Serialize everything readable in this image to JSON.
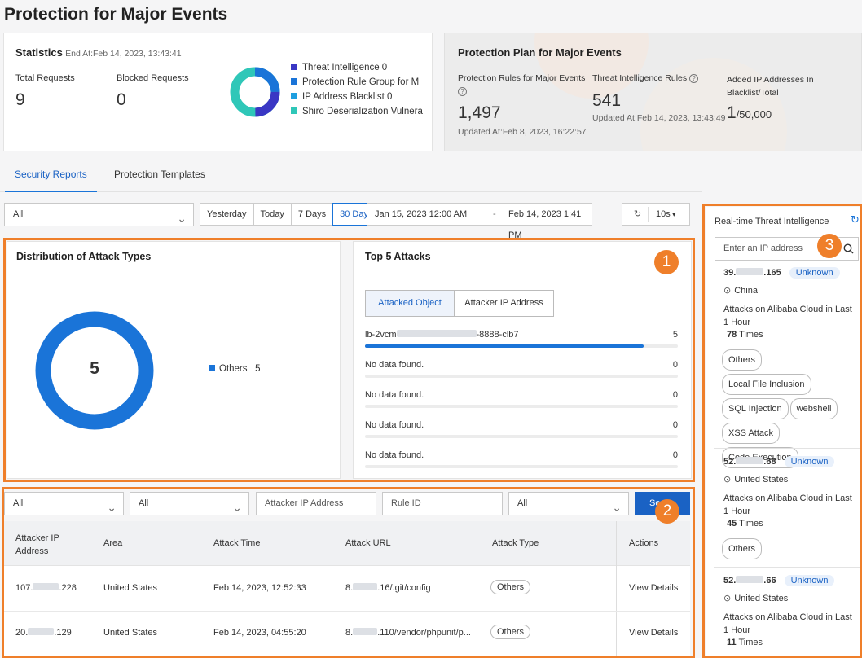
{
  "page_title": "Protection for Major Events",
  "statistics": {
    "title": "Statistics",
    "end_at": "End At:Feb 14, 2023, 13:43:41",
    "total_label": "Total Requests",
    "total_value": "9",
    "blocked_label": "Blocked Requests",
    "blocked_value": "0",
    "legend": [
      {
        "label": "Threat Intelligence 0",
        "color": "#3a37c4"
      },
      {
        "label": "Protection Rule Group for M",
        "color": "#1a74d8"
      },
      {
        "label": "IP Address Blacklist 0",
        "color": "#1f9fe0"
      },
      {
        "label": "Shiro Deserialization Vulnera",
        "color": "#2fc7b8"
      }
    ]
  },
  "plan": {
    "title": "Protection Plan for Major Events",
    "rules_label": "Protection Rules for Major Events",
    "rules_value": "1,497",
    "rules_updated": "Updated At:Feb 8, 2023, 16:22:57",
    "ti_label": "Threat Intelligence Rules",
    "ti_value": "541",
    "ti_updated": "Updated At:Feb 14, 2023, 13:43:49",
    "blacklist_label": "Added IP Addresses In Blacklist/Total",
    "blacklist_value": "1",
    "blacklist_total": "/50,000"
  },
  "tabs": [
    {
      "label": "Security Reports",
      "active": true
    },
    {
      "label": "Protection Templates",
      "active": false
    }
  ],
  "filter": {
    "scope": "All",
    "ranges": [
      "Yesterday",
      "Today",
      "7 Days",
      "30 Days"
    ],
    "active_range": "30 Days",
    "start": "Jan 15, 2023 12:00 AM",
    "sep": "-",
    "end": "Feb 14, 2023 1:41 PM",
    "refresh_interval": "10s"
  },
  "distribution": {
    "title": "Distribution of Attack Types",
    "total": "5",
    "legend_label": "Others",
    "legend_value": "5"
  },
  "top5": {
    "title": "Top 5 Attacks",
    "tab_object": "Attacked Object",
    "tab_ip": "Attacker IP Address",
    "rows": [
      {
        "name_prefix": "lb-2vcm",
        "name_suffix": "-8888-clb7",
        "value": "5",
        "fraction": 0.99
      },
      {
        "name_prefix": "No data found.",
        "name_suffix": "",
        "value": "0",
        "fraction": 0
      },
      {
        "name_prefix": "No data found.",
        "name_suffix": "",
        "value": "0",
        "fraction": 0
      },
      {
        "name_prefix": "No data found.",
        "name_suffix": "",
        "value": "0",
        "fraction": 0
      },
      {
        "name_prefix": "No data found.",
        "name_suffix": "",
        "value": "0",
        "fraction": 0
      }
    ]
  },
  "table_filters": {
    "select1": "All",
    "select2": "All",
    "ip_placeholder": "Attacker IP Address",
    "rule_placeholder": "Rule ID",
    "select3": "All",
    "search_btn": "Se"
  },
  "table": {
    "headers": [
      "Attacker IP Address",
      "Area",
      "Attack Time",
      "Attack URL",
      "Attack Type",
      "Actions"
    ],
    "rows": [
      {
        "ip_a": "107.",
        "ip_b": ".228",
        "area": "United States",
        "time": "Feb 14, 2023, 12:52:33",
        "url_a": "8.",
        "url_b": ".16/.git/config",
        "type": "Others",
        "action": "View Details"
      },
      {
        "ip_a": "20.",
        "ip_b": ".129",
        "area": "United States",
        "time": "Feb 14, 2023, 04:55:20",
        "url_a": "8.",
        "url_b": ".110/vendor/phpunit/p...",
        "type": "Others",
        "action": "View Details"
      }
    ]
  },
  "threat": {
    "title": "Real-time Threat Intelligence",
    "search_placeholder": "Enter an IP address",
    "items": [
      {
        "ip_a": "39.",
        "ip_b": ".165",
        "status": "Unknown",
        "country": "China",
        "desc": "Attacks on Alibaba Cloud in Last 1 Hour",
        "times": "78",
        "times_label": "Times",
        "tags": [
          "Others",
          "Local File Inclusion",
          "SQL Injection",
          "webshell",
          "XSS Attack",
          "Code Execution"
        ]
      },
      {
        "ip_a": "52.",
        "ip_b": ".68",
        "status": "Unknown",
        "country": "United States",
        "desc": "Attacks on Alibaba Cloud in Last 1 Hour",
        "times": "45",
        "times_label": "Times",
        "tags": [
          "Others"
        ]
      },
      {
        "ip_a": "52.",
        "ip_b": ".66",
        "status": "Unknown",
        "country": "United States",
        "desc": "Attacks on Alibaba Cloud in Last 1 Hour",
        "times": "11",
        "times_label": "Times",
        "tags": []
      }
    ]
  },
  "markers": [
    "1",
    "2",
    "3"
  ]
}
